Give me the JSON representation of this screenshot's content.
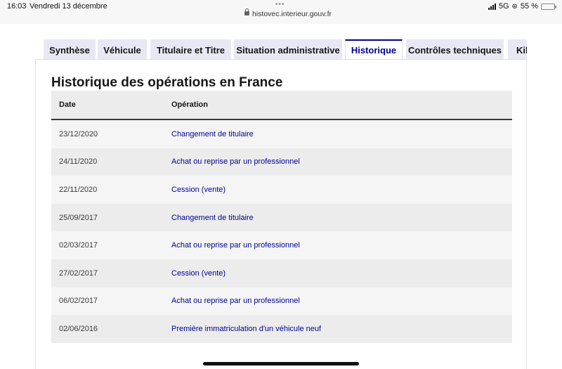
{
  "status_bar": {
    "time": "16:03",
    "date": "Vendredi 13 décembre",
    "dots": "•••",
    "url": "histovec.interieur.gouv.fr",
    "network": "5G",
    "battery_text": "55 %",
    "battery_level": 0.55,
    "icons": [
      "signal-icon",
      "lock-icon",
      "orientation-lock-icon",
      "battery-icon"
    ]
  },
  "tabs": [
    {
      "label": "Synthèse",
      "active": false
    },
    {
      "label": "Véhicule",
      "active": false
    },
    {
      "label": "Titulaire et Titre",
      "active": false
    },
    {
      "label": "Situation administrative",
      "active": false
    },
    {
      "label": "Historique",
      "active": true
    },
    {
      "label": "Contrôles techniques",
      "active": false
    },
    {
      "label": "Kilo",
      "active": false
    }
  ],
  "colors": {
    "accent": "#000091",
    "tab_bg": "#e8e8f5",
    "row_odd": "#f5f5f5",
    "row_even": "#ececec"
  },
  "main": {
    "title": "Historique des opérations en France",
    "table": {
      "headers": {
        "date": "Date",
        "operation": "Opération"
      },
      "rows": [
        {
          "date": "23/12/2020",
          "operation": "Changement de titulaire"
        },
        {
          "date": "24/11/2020",
          "operation": "Achat ou reprise par un professionnel"
        },
        {
          "date": "22/11/2020",
          "operation": "Cession (vente)"
        },
        {
          "date": "25/09/2017",
          "operation": "Changement de titulaire"
        },
        {
          "date": "02/03/2017",
          "operation": "Achat ou reprise par un professionnel"
        },
        {
          "date": "27/02/2017",
          "operation": "Cession (vente)"
        },
        {
          "date": "06/02/2017",
          "operation": "Achat ou reprise par un professionnel"
        },
        {
          "date": "02/06/2016",
          "operation": "Première immatriculation d'un véhicule neuf"
        }
      ]
    }
  }
}
